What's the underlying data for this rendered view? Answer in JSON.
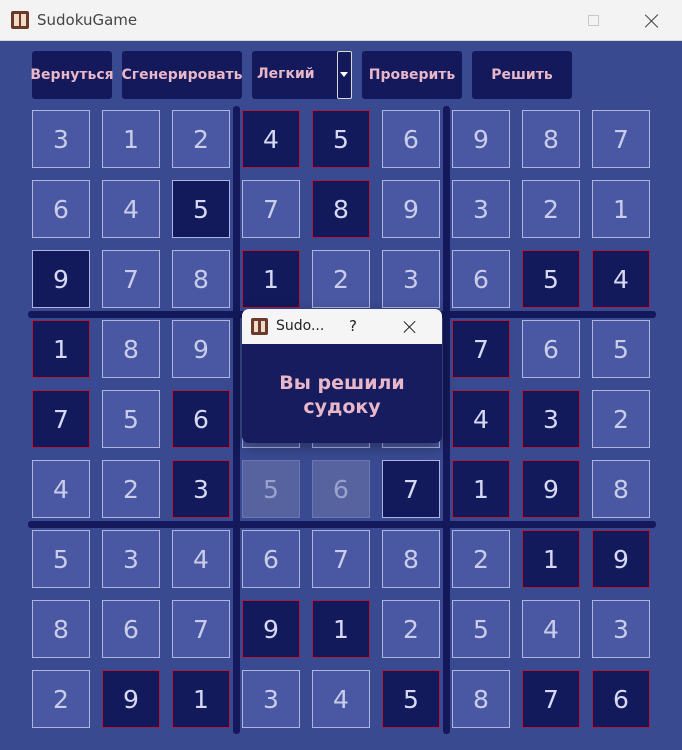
{
  "window": {
    "title": "SudokuGame"
  },
  "toolbar": {
    "back_label": "Вернуться",
    "generate_label": "Сгенерировать",
    "difficulty_value": "Легкий",
    "check_label": "Проверить",
    "solve_label": "Решить"
  },
  "board": {
    "values": [
      [
        "3",
        "1",
        "2",
        "4",
        "5",
        "6",
        "9",
        "8",
        "7"
      ],
      [
        "6",
        "4",
        "5",
        "7",
        "8",
        "9",
        "3",
        "2",
        "1"
      ],
      [
        "9",
        "7",
        "8",
        "1",
        "2",
        "3",
        "6",
        "5",
        "4"
      ],
      [
        "1",
        "8",
        "9",
        "",
        "",
        "",
        "7",
        "6",
        "5"
      ],
      [
        "7",
        "5",
        "6",
        "",
        "",
        "",
        "4",
        "3",
        "2"
      ],
      [
        "4",
        "2",
        "3",
        "5",
        "6",
        "7",
        "1",
        "9",
        "8"
      ],
      [
        "5",
        "3",
        "4",
        "6",
        "7",
        "8",
        "2",
        "1",
        "9"
      ],
      [
        "8",
        "6",
        "7",
        "9",
        "1",
        "2",
        "5",
        "4",
        "3"
      ],
      [
        "2",
        "9",
        "1",
        "3",
        "4",
        "5",
        "8",
        "7",
        "6"
      ]
    ],
    "cell_style": [
      [
        "n",
        "n",
        "n",
        "r",
        "r",
        "n",
        "n",
        "n",
        "n"
      ],
      [
        "n",
        "n",
        "g",
        "n",
        "r",
        "n",
        "n",
        "n",
        "n"
      ],
      [
        "g",
        "n",
        "n",
        "r",
        "n",
        "n",
        "n",
        "r",
        "r"
      ],
      [
        "r",
        "n",
        "n",
        "n",
        "n",
        "n",
        "r",
        "n",
        "n"
      ],
      [
        "r",
        "n",
        "r",
        "n",
        "n",
        "n",
        "r",
        "r",
        "n"
      ],
      [
        "n",
        "n",
        "r",
        "d",
        "d",
        "g",
        "r",
        "r",
        "n"
      ],
      [
        "n",
        "n",
        "n",
        "n",
        "n",
        "n",
        "n",
        "r",
        "r"
      ],
      [
        "n",
        "n",
        "n",
        "r",
        "r",
        "n",
        "n",
        "n",
        "n"
      ],
      [
        "n",
        "r",
        "r",
        "n",
        "n",
        "r",
        "n",
        "r",
        "r"
      ]
    ],
    "colors": {
      "background": "#3a4a91",
      "cell": "#4a58a3",
      "given_cell": "#131a5c",
      "error_border": "#b01a3a",
      "text_accent": "#e8b7c9"
    }
  },
  "dialog": {
    "title": "Sudo...",
    "help_label": "?",
    "message_line1": "Вы решили",
    "message_line2": "судоку"
  }
}
